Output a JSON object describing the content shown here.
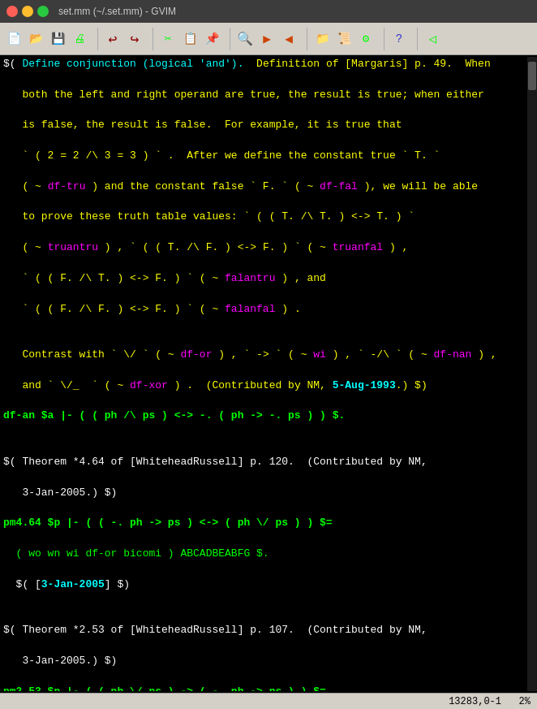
{
  "titlebar": {
    "title": "set.mm (~/.set.mm) - GVIM"
  },
  "toolbar": {
    "icons": [
      "new",
      "open",
      "save",
      "print",
      "sep",
      "cut",
      "copy",
      "paste",
      "sep",
      "find",
      "forward",
      "back",
      "sep",
      "file1",
      "file2",
      "macro",
      "sep",
      "help",
      "sep",
      "back2"
    ]
  },
  "statusbar": {
    "position": "13283,0-1",
    "percent": "2%"
  },
  "editor": {
    "content": "visible"
  }
}
